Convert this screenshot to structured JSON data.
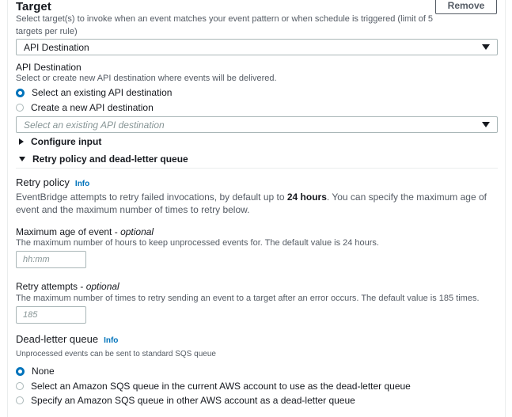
{
  "target": {
    "title": "Target",
    "description": "Select target(s) to invoke when an event matches your event pattern or when schedule is triggered (limit of 5 targets per rule)",
    "remove_label": "Remove",
    "selected_type": "API Destination"
  },
  "api_destination": {
    "label": "API Destination",
    "description": "Select or create new API destination where events will be delivered.",
    "options": [
      {
        "label": "Select an existing API destination",
        "checked": true
      },
      {
        "label": "Create a new API destination",
        "checked": false
      }
    ],
    "select_placeholder": "Select an existing API destination"
  },
  "expanders": {
    "configure_input": "Configure input",
    "retry_dlq": "Retry policy and dead-letter queue"
  },
  "retry_policy": {
    "title": "Retry policy",
    "info": "Info",
    "desc_prefix": "EventBridge attempts to retry failed invocations, by default up to ",
    "desc_bold": "24 hours",
    "desc_suffix": ". You can specify the maximum age of event and the maximum number of times to retry below."
  },
  "max_age": {
    "label": "Maximum age of event - ",
    "label_optional": "optional",
    "description": "The maximum number of hours to keep unprocessed events for. The default value is 24 hours.",
    "placeholder": "hh:mm"
  },
  "retry_attempts": {
    "label": "Retry attempts - ",
    "label_optional": "optional",
    "description": "The maximum number of times to retry sending an event to a target after an error occurs. The default value is 185 times.",
    "placeholder": "185"
  },
  "dlq": {
    "title": "Dead-letter queue",
    "info": "Info",
    "description": "Unprocessed events can be sent to standard SQS queue",
    "options": [
      {
        "label": "None",
        "checked": true
      },
      {
        "label": "Select an Amazon SQS queue in the current AWS account to use as the dead-letter queue",
        "checked": false
      },
      {
        "label": "Specify an Amazon SQS queue in other AWS account as a dead-letter queue",
        "checked": false
      }
    ]
  },
  "colors": {
    "accent": "#0073bb",
    "text": "#16191f",
    "muted": "#545b64",
    "border": "#aab7b8"
  }
}
